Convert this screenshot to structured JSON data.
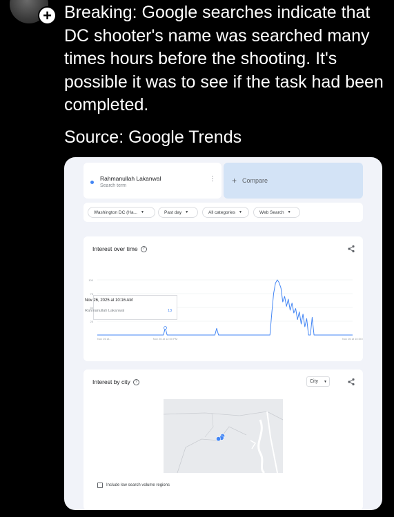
{
  "post": {
    "follow_icon": "plus-icon",
    "text": "Breaking: Google searches indicate that DC shooter's name was searched many times hours before the shooting. It's possible it was to see if the task had been completed.",
    "source": "Source: Google Trends"
  },
  "trends": {
    "term": {
      "name": "Rahmanullah Lakanwal",
      "sub": "Search term",
      "color": "#4285f4"
    },
    "compare_label": "Compare",
    "filters": [
      "Washington DC (Ha...",
      "Past day",
      "All categories",
      "Web Search"
    ],
    "interest_over_time": {
      "title": "Interest over time",
      "tooltip": {
        "date": "Nov 26, 2025 at 10:16 AM",
        "term": "Rahmanullah Lakanwal",
        "value": "13"
      }
    },
    "interest_by_city": {
      "title": "Interest by city",
      "select": "City",
      "low_volume_label": "Include low search volume regions"
    }
  },
  "chart_data": {
    "type": "line",
    "y_ticks": [
      "100",
      "75",
      "50",
      "25"
    ],
    "x_tick_labels": [
      "Nov 26 at...",
      "Nov 26 at 12:00 PM",
      "Nov 26 at 10:00 PM"
    ],
    "ylim": [
      0,
      100
    ],
    "series": [
      {
        "name": "Rahmanullah Lakanwal",
        "values": [
          0,
          0,
          0,
          0,
          0,
          0,
          0,
          0,
          0,
          0,
          0,
          0,
          0,
          0,
          0,
          0,
          0,
          0,
          0,
          0,
          0,
          0,
          0,
          0,
          0,
          0,
          0,
          0,
          0,
          0,
          0,
          0,
          0,
          0,
          0,
          0,
          0,
          13,
          0,
          0,
          0,
          0,
          0,
          0,
          0,
          0,
          0,
          0,
          0,
          0,
          0,
          0,
          0,
          0,
          0,
          0,
          0,
          0,
          0,
          0,
          0,
          0,
          0,
          0,
          0,
          12,
          0,
          0,
          0,
          0,
          0,
          0,
          0,
          0,
          0,
          0,
          0,
          0,
          0,
          0,
          0,
          0,
          0,
          0,
          0,
          0,
          0,
          0,
          0,
          0,
          0,
          0,
          0,
          0,
          0,
          40,
          75,
          94,
          100,
          95,
          85,
          60,
          70,
          52,
          65,
          45,
          58,
          40,
          48,
          28,
          42,
          20,
          38,
          15,
          30,
          0,
          0,
          32,
          0,
          0,
          0,
          0,
          0,
          0,
          0,
          0,
          0,
          0,
          0,
          0,
          0,
          0,
          0,
          0,
          0,
          0,
          0,
          0,
          0,
          0
        ]
      }
    ]
  },
  "map_pins": [
    {
      "lat": 38.9,
      "lon": -77.03
    },
    {
      "lat": 38.8,
      "lon": -77.07
    },
    {
      "lat": 38.75,
      "lon": -77.2
    }
  ]
}
